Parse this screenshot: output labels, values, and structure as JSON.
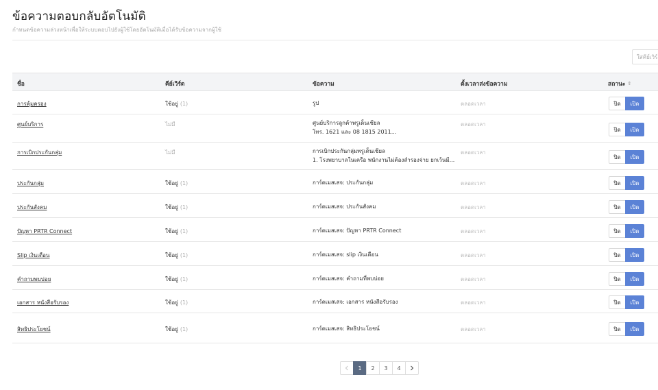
{
  "header": {
    "title": "ข้อความตอบกลับอัตโนมัติ",
    "subtitle": "กำหนดข้อความล่วงหน้าเพื่อให้ระบบตอบไปยังผู้ใช้โดยอัตโนมัติเมื่อได้รับข้อความจากผู้ใช้"
  },
  "search": {
    "placeholder": "ใส่คีย์เวิร์ด"
  },
  "table": {
    "headers": {
      "name": "ชื่อ",
      "keyword": "คีย์เวิร์ด",
      "message": "ข้อความ",
      "schedule": "ตั้งเวลาส่งข้อความ",
      "status": "สถานะ"
    },
    "toggle_off_label": "ปิด",
    "toggle_on_label": "เปิด",
    "rows": [
      {
        "name": "การคุ้มครอง",
        "keyword": "ใช้อยู่",
        "count": "(1)",
        "message_line1": "รูป",
        "message_line2": "",
        "schedule": "ตลอดเวลา",
        "status": "on"
      },
      {
        "name": "ศูนย์บริการ",
        "keyword": "ไม่มี",
        "count": "",
        "message_line1": "ศูนย์บริการลูกค้าพรูเด็นเชียล",
        "message_line2": "โทร. 1621 และ 08 1815 2011...",
        "schedule": "ตลอดเวลา",
        "status": "on"
      },
      {
        "name": "การเบิกประกันกลุ่ม",
        "keyword": "ไม่มี",
        "count": "",
        "message_line1": "การเบิกประกันกลุ่มพรูเด็นเชียล",
        "message_line2": "1. โรงพยาบาลในเครือ พนักงานไม่ต้องสำรองจ่าย ยกเว้นมี...",
        "schedule": "ตลอดเวลา",
        "status": "on"
      },
      {
        "name": "ประกันกลุ่ม",
        "keyword": "ใช้อยู่",
        "count": "(1)",
        "message_line1": "การ์ดเมสเสจ: ประกันกลุ่ม",
        "message_line2": "",
        "schedule": "ตลอดเวลา",
        "status": "on"
      },
      {
        "name": "ประกันสังคม",
        "keyword": "ใช้อยู่",
        "count": "(1)",
        "message_line1": "การ์ดเมสเสจ: ประกันสังคม",
        "message_line2": "",
        "schedule": "ตลอดเวลา",
        "status": "on"
      },
      {
        "name": "ปัญหา PRTR Connect",
        "keyword": "ใช้อยู่",
        "count": "(1)",
        "message_line1": "การ์ดเมสเสจ: ปัญหา PRTR Connect",
        "message_line2": "",
        "schedule": "ตลอดเวลา",
        "status": "on"
      },
      {
        "name": "Slip เงินเดือน",
        "keyword": "ใช้อยู่",
        "count": "(1)",
        "message_line1": "การ์ดเมสเสจ: slip เงินเดือน",
        "message_line2": "",
        "schedule": "ตลอดเวลา",
        "status": "on"
      },
      {
        "name": "คำถามพบบ่อย",
        "keyword": "ใช้อยู่",
        "count": "(1)",
        "message_line1": "การ์ดเมสเสจ: คำถามที่พบบ่อย",
        "message_line2": "",
        "schedule": "ตลอดเวลา",
        "status": "on"
      },
      {
        "name": "เอกสาร หนังสือรับรอง",
        "keyword": "ใช้อยู่",
        "count": "(1)",
        "message_line1": "การ์ดเมสเสจ: เอกสาร หนังสือรับรอง",
        "message_line2": "",
        "schedule": "ตลอดเวลา",
        "status": "on"
      },
      {
        "name": "สิทธิประโยชน์",
        "keyword": "ใช้อยู่",
        "count": "(1)",
        "message_line1": "การ์ดเมสเสจ: สิทธิประโยชน์",
        "message_line2": "",
        "schedule": "ตลอดเวลา",
        "status": "on"
      }
    ]
  },
  "pagination": {
    "pages": [
      "1",
      "2",
      "3",
      "4"
    ],
    "current": "1"
  },
  "colors": {
    "accent": "#5b82d6",
    "pagination_active": "#5a6a82",
    "header_bg": "#f3f4f6"
  }
}
